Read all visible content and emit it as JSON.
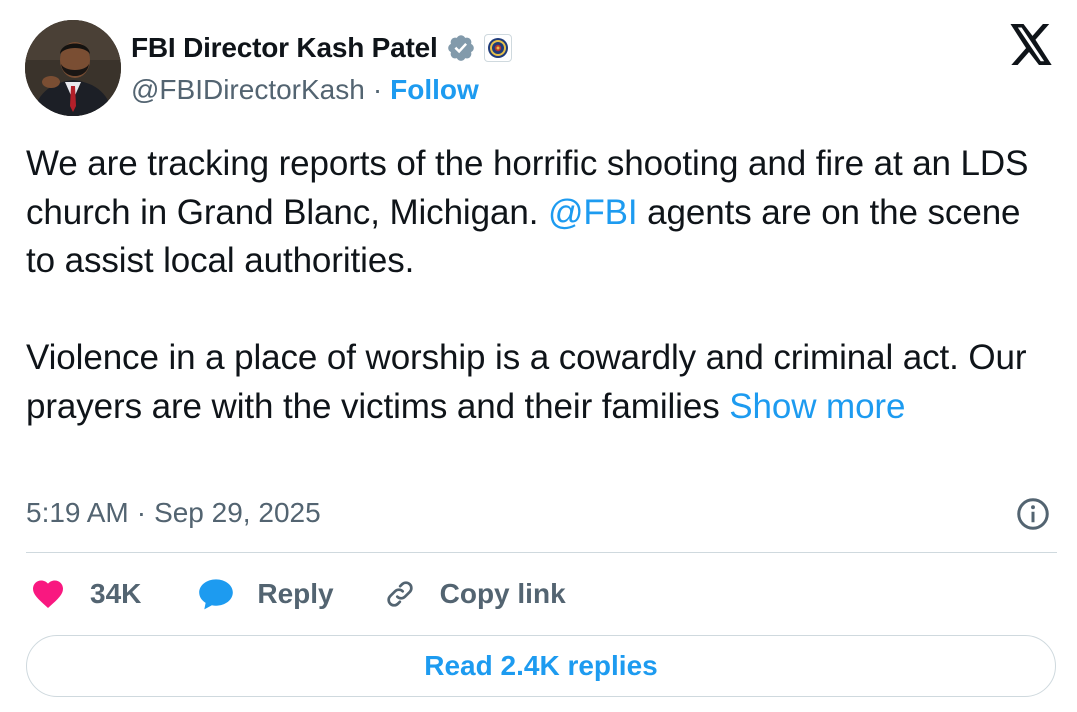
{
  "author": {
    "display_name": "FBI Director Kash Patel",
    "handle": "@FBIDirectorKash",
    "separator": "·",
    "follow_label": "Follow"
  },
  "tweet": {
    "para1_before_mention": "We are tracking reports of the horrific shooting and fire at an LDS church in Grand Blanc, Michigan. ",
    "mention": "@FBI",
    "para1_after_mention": " agents are on the scene to assist local authorities.",
    "para2_text": "Violence in a place of worship is a cowardly and criminal act. Our prayers are with the victims and their families ",
    "show_more_label": "Show more"
  },
  "meta": {
    "time": "5:19 AM",
    "separator": "·",
    "date": "Sep 29, 2025"
  },
  "actions": {
    "like_count": "34K",
    "reply_label": "Reply",
    "copy_link_label": "Copy link"
  },
  "read_replies_label": "Read 2.4K replies",
  "colors": {
    "accent": "#1d9bf0",
    "text_primary": "#0f1419",
    "text_secondary": "#536471",
    "like": "#f91880",
    "divider": "#cfd9de"
  },
  "icons": {
    "verified": "verified-badge-icon",
    "affiliation": "fbi-seal-icon",
    "brand": "x-logo-icon",
    "info": "info-icon",
    "like": "heart-icon",
    "reply": "speech-bubble-icon",
    "copy": "link-icon"
  }
}
